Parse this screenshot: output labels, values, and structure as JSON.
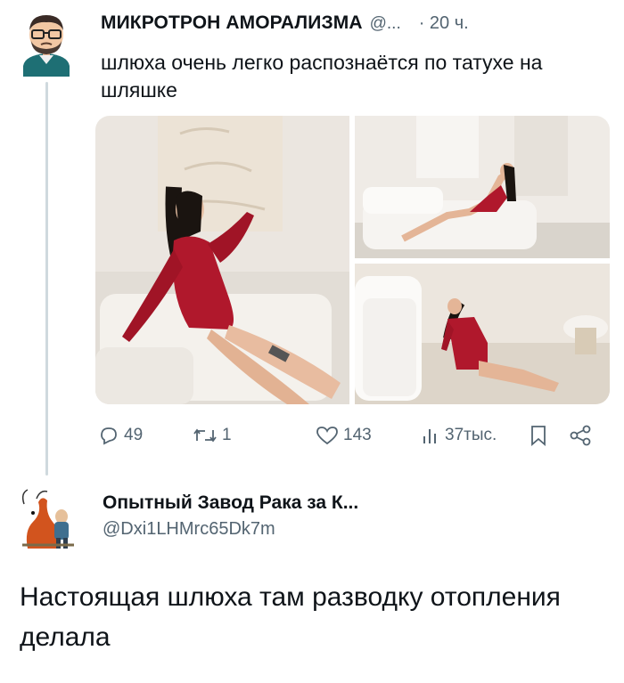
{
  "tweet": {
    "author_name": "МИКРОТРОН АМОРАЛИЗМА",
    "author_handle": "@...",
    "time": "· 20 ч.",
    "text": "шлюха очень легко распознаётся по татухе на шляшке",
    "media_count": 3,
    "actions": {
      "replies": "49",
      "retweets": "1",
      "likes": "143",
      "views": "37тыс."
    }
  },
  "reply": {
    "author_name": "Опытный Завод Рака за К...",
    "author_handle": "@Dxi1LHMrc65Dk7m",
    "text": "Настоящая шлюха там разводку отопления делала"
  },
  "colors": {
    "text": "#0f1419",
    "secondary": "#536471",
    "thread_line": "#cfd9de",
    "bodysuit": "#b0182c"
  },
  "icons": [
    "reply-icon",
    "retweet-icon",
    "like-icon",
    "views-icon",
    "bookmark-icon",
    "share-icon"
  ]
}
